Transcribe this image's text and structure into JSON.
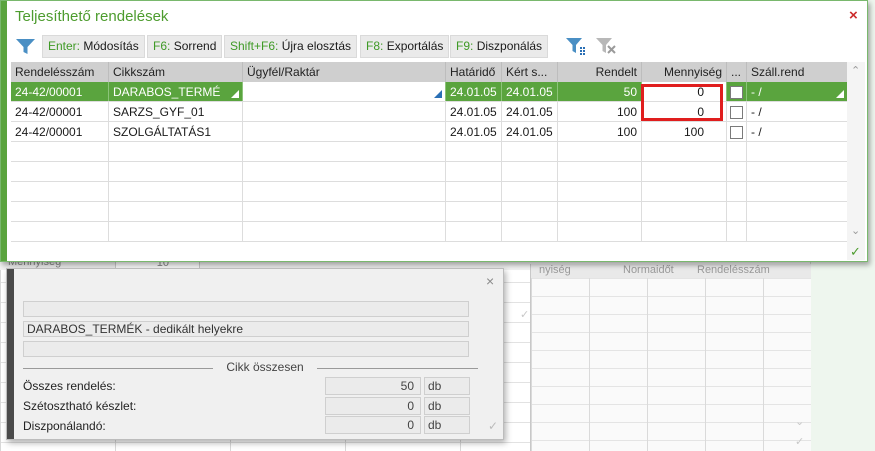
{
  "dialog": {
    "title": "Teljesíthető rendelések",
    "close_glyph": "×",
    "toolbar": [
      {
        "key": "Enter:",
        "label": "Módosítás"
      },
      {
        "key": "F6:",
        "label": "Sorrend"
      },
      {
        "key": "Shift+F6:",
        "label": "Újra elosztás"
      },
      {
        "key": "F8:",
        "label": "Exportálás"
      },
      {
        "key": "F9:",
        "label": "Diszponálás"
      }
    ],
    "icons": [
      "filter-icon",
      "filter-apply-icon",
      "filter-clear-icon"
    ],
    "table": {
      "columns": [
        "Rendelésszám",
        "Cikkszám",
        "Ügyfél/Raktár",
        "Határidő",
        "Kért s...",
        "Rendelt",
        "Mennyiség",
        "...",
        "Száll.rend"
      ],
      "rows": [
        {
          "rendelesszam": "24-42/00001",
          "cikkszam": "DARABOS_TERMÉ",
          "ugyfel": "",
          "hatarido": "24.01.05",
          "kert": "24.01.05",
          "rendelt": "50",
          "mennyiseg": "0",
          "checked": false,
          "szallrend": "- /"
        },
        {
          "rendelesszam": "24-42/00001",
          "cikkszam": "SARZS_GYF_01",
          "ugyfel": "",
          "hatarido": "24.01.05",
          "kert": "24.01.05",
          "rendelt": "100",
          "mennyiseg": "0",
          "checked": false,
          "szallrend": "- /"
        },
        {
          "rendelesszam": "24-42/00001",
          "cikkszam": "SZOLGÁLTATÁS1",
          "ugyfel": "",
          "hatarido": "24.01.05",
          "kert": "24.01.05",
          "rendelt": "100",
          "mennyiseg": "100",
          "checked": false,
          "szallrend": "- /"
        }
      ],
      "selected_row": 0
    },
    "ok_glyph": "✓"
  },
  "info_panel": {
    "close_glyph": "×",
    "field1": "",
    "description": "DARABOS_TERMÉK - dedikált helyekre",
    "field3": "",
    "section_title": "Cikk összesen",
    "summary": [
      {
        "label": "Összes rendelés:",
        "value": "50",
        "unit": "db"
      },
      {
        "label": "Szétosztható készlet:",
        "value": "0",
        "unit": "db"
      },
      {
        "label": "Diszponálandó:",
        "value": "0",
        "unit": "db"
      }
    ],
    "ok_glyph": "✓"
  },
  "background": {
    "left_label": "Mennyiség",
    "left_value": "10",
    "headers": [
      "nyiség",
      "Normaidőt",
      "Rendelésszám"
    ]
  },
  "colors": {
    "accent": "#5aa43e",
    "title": "#4d9c2e",
    "highlight": "#e01e1e",
    "close": "#cc2b2b"
  }
}
